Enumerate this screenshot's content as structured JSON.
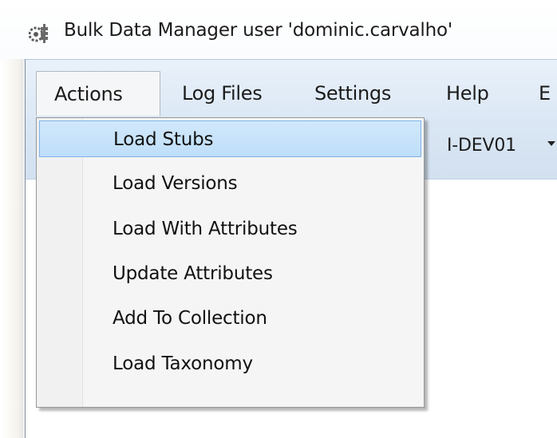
{
  "window": {
    "title": "Bulk Data Manager user 'dominic.carvalho'"
  },
  "menubar": {
    "items": [
      {
        "label": "Actions"
      },
      {
        "label": "Log Files"
      },
      {
        "label": "Settings"
      },
      {
        "label": "Help"
      },
      {
        "label": "E"
      }
    ]
  },
  "toolbar": {
    "environment": "I-DEV01"
  },
  "actions_menu": {
    "items": [
      {
        "label": "Load Stubs",
        "highlighted": true
      },
      {
        "label": "Load Versions"
      },
      {
        "label": "Load With Attributes"
      },
      {
        "label": "Update Attributes"
      },
      {
        "label": "Add To Collection"
      },
      {
        "label": "Load Taxonomy"
      }
    ]
  },
  "icons": {
    "app": "gear-database-icon",
    "dropdown": "chevron-down-icon"
  },
  "colors": {
    "menubar_bg": "#dce8f5",
    "highlight_bg": "#c8e3fa",
    "highlight_border": "#7db3e8"
  }
}
